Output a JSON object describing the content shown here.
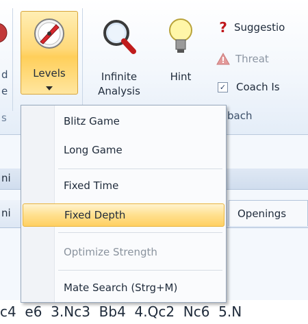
{
  "ribbon": {
    "left_partial_label_1": "d",
    "left_partial_label_2": "e",
    "left_group_partial": "s",
    "levels": {
      "label": "Levels"
    },
    "infinite_analysis": {
      "line1": "Infinite",
      "line2": "Analysis"
    },
    "hint": {
      "label": "Hint"
    },
    "suggestion": {
      "label": "Suggestio"
    },
    "threat": {
      "label": "Threat"
    },
    "coach_is": {
      "label": "Coach Is ",
      "checked": "✓"
    },
    "group_label_partial": "bach"
  },
  "panes": {
    "row1_partial": "ni",
    "row2_partial": "ni",
    "openings_tab": "Openings"
  },
  "notation": {
    "moves": "c4  e6  3.Nc3  Bb4  4.Qc2  Nc6  5.N"
  },
  "levels_menu": {
    "items": [
      {
        "label": "Blitz Game"
      },
      {
        "label": "Long Game"
      },
      {
        "label": "Fixed Time"
      },
      {
        "label": "Fixed Depth",
        "highlighted": true
      },
      {
        "label": "Optimize Strength",
        "disabled": true
      },
      {
        "label": "Mate Search (Strg+M)"
      }
    ]
  },
  "colors": {
    "highlight": "#ffd97a",
    "threat_icon": "#e39a9a",
    "suggestion_icon": "#c0181c"
  }
}
